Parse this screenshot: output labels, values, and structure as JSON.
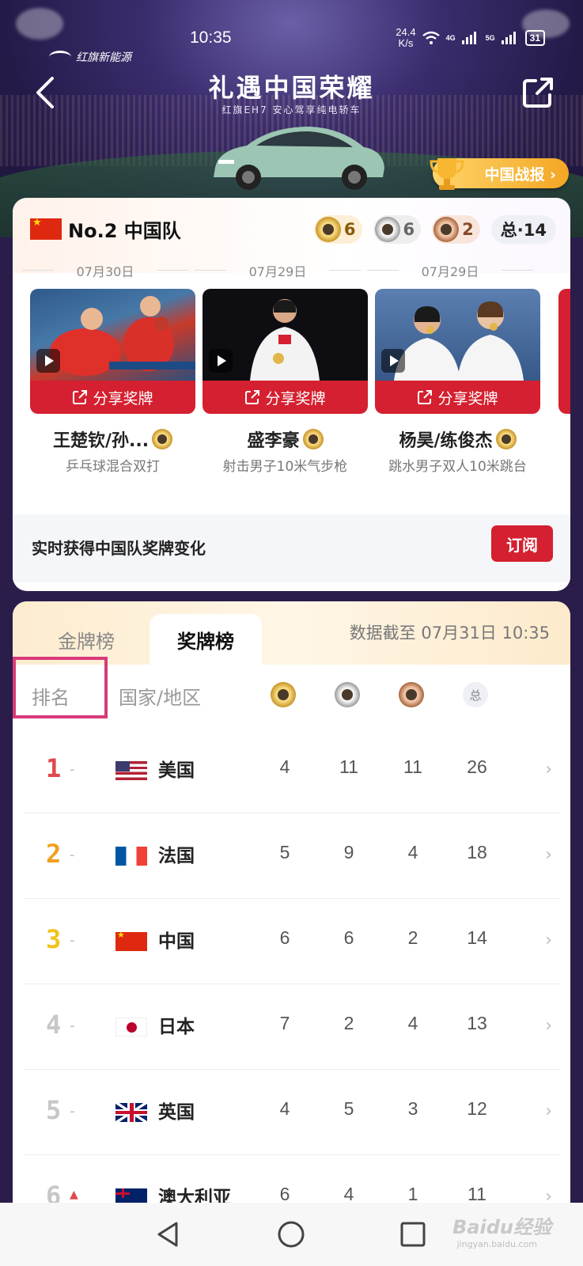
{
  "status_bar": {
    "time": "10:35",
    "speed_value": "24.4",
    "speed_unit": "K/s",
    "net1": "4G",
    "net2": "5G",
    "battery": "31"
  },
  "brand": {
    "name": "红旗新能源"
  },
  "header": {
    "title": "礼遇中国荣耀",
    "subtitle": "红旗EH7  安心驾享纯电轿车",
    "report_button": "中国战报 ›"
  },
  "team": {
    "name": "No.2 中国队",
    "gold": "6",
    "silver": "6",
    "bronze": "2",
    "total": "总·14"
  },
  "athletes": [
    {
      "date": "07月30日",
      "share": "分享奖牌",
      "name": "王楚钦/孙...",
      "event": "乒乓球混合双打"
    },
    {
      "date": "07月29日",
      "share": "分享奖牌",
      "name": "盛李豪",
      "event": "射击男子10米气步枪"
    },
    {
      "date": "07月29日",
      "share": "分享奖牌",
      "name": "杨昊/练俊杰",
      "event": "跳水男子双人10米跳台"
    }
  ],
  "subscribe": {
    "text": "实时获得中国队奖牌变化",
    "button": "订阅"
  },
  "medal_table": {
    "tabs": [
      "金牌榜",
      "奖牌榜"
    ],
    "active_tab": "奖牌榜",
    "as_of": "数据截至 07月31日 10:35",
    "headers": {
      "rank": "排名",
      "country": "国家/地区",
      "total": "总"
    },
    "rows": [
      {
        "rank": "1",
        "trend": "-",
        "country": "美国",
        "flag": "us",
        "gold": "4",
        "silver": "11",
        "bronze": "11",
        "total": "26",
        "rank_color": "#e0484f"
      },
      {
        "rank": "2",
        "trend": "-",
        "country": "法国",
        "flag": "fr",
        "gold": "5",
        "silver": "9",
        "bronze": "4",
        "total": "18",
        "rank_color": "#f0a01e"
      },
      {
        "rank": "3",
        "trend": "-",
        "country": "中国",
        "flag": "cn",
        "gold": "6",
        "silver": "6",
        "bronze": "2",
        "total": "14",
        "rank_color": "#f2c21a"
      },
      {
        "rank": "4",
        "trend": "-",
        "country": "日本",
        "flag": "jp",
        "gold": "7",
        "silver": "2",
        "bronze": "4",
        "total": "13",
        "rank_color": "#c7c7c7"
      },
      {
        "rank": "5",
        "trend": "-",
        "country": "英国",
        "flag": "gb",
        "gold": "4",
        "silver": "5",
        "bronze": "3",
        "total": "12",
        "rank_color": "#c7c7c7"
      },
      {
        "rank": "6",
        "trend": "▲",
        "country": "澳大利亚",
        "flag": "au",
        "gold": "6",
        "silver": "4",
        "bronze": "1",
        "total": "11",
        "rank_color": "#c7c7c7"
      }
    ]
  },
  "watermark": {
    "text": "Baidu经验",
    "sub": "jingyan.baidu.com"
  },
  "icons": {
    "back": "chevron-left-icon",
    "share": "share-icon",
    "play": "play-icon",
    "share_medal": "share-icon",
    "nav_back": "triangle-back-icon",
    "nav_home": "circle-home-icon",
    "nav_recent": "square-recent-icon"
  },
  "colors": {
    "accent_red": "#d42030",
    "gold": "#f3a623",
    "highlight_box": "#d83a7a"
  }
}
